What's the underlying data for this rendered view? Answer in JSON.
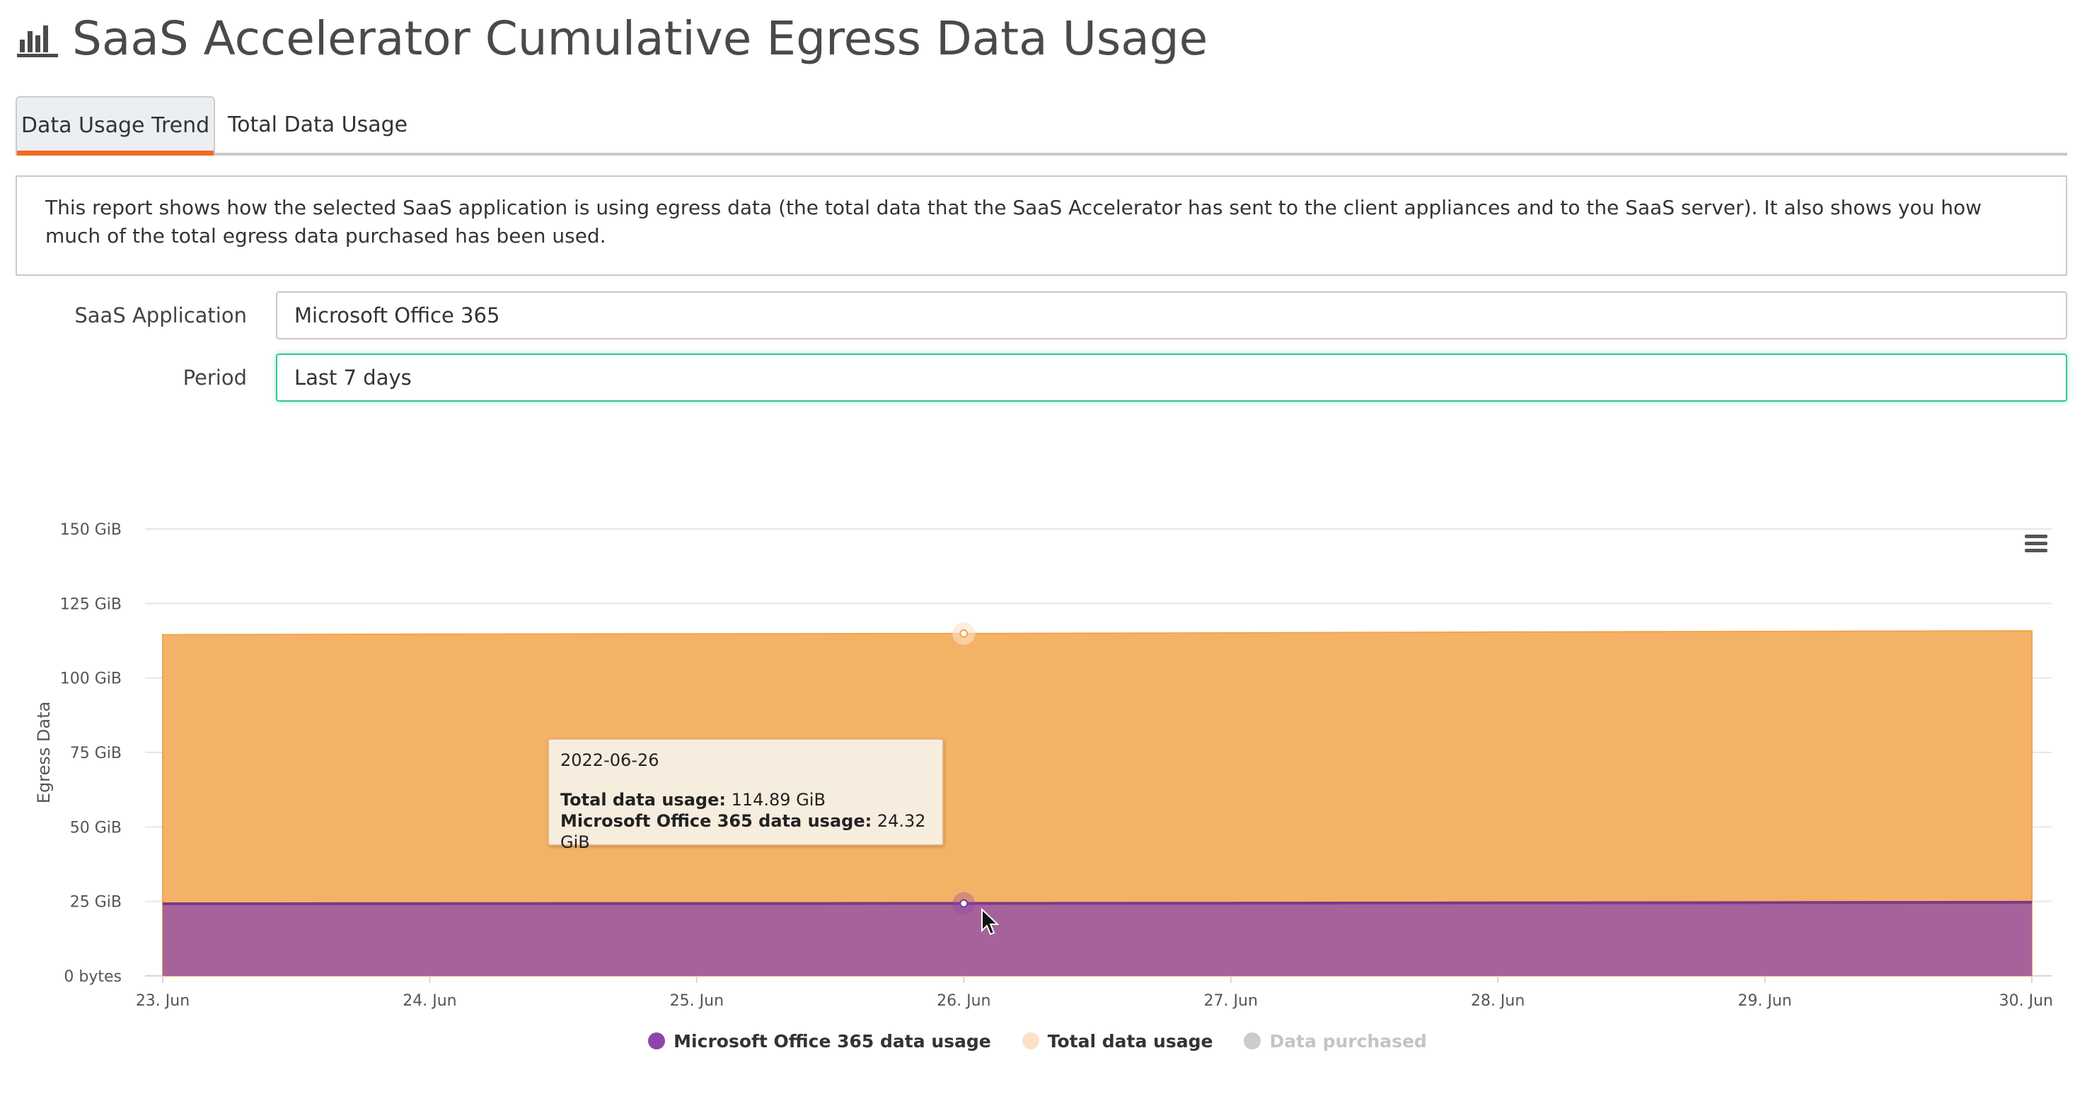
{
  "header": {
    "title": "SaaS Accelerator Cumulative Egress Data Usage",
    "icon": "bar-chart-icon"
  },
  "tabs": [
    {
      "label": "Data Usage Trend",
      "active": true
    },
    {
      "label": "Total Data Usage",
      "active": false
    }
  ],
  "description": "This report shows how the selected SaaS application is using egress data (the total data that the SaaS Accelerator has sent to the client appliances and to the SaaS server). It also shows you how much of the total egress data purchased has been used.",
  "form": {
    "application_label": "SaaS Application",
    "application_value": "Microsoft Office 365",
    "period_label": "Period",
    "period_value": "Last 7 days"
  },
  "colors": {
    "total_area": "#f4b266",
    "app_area": "#a6629b",
    "app_line": "#7b3a8a",
    "accent_tab": "#f26b22",
    "focus_border": "#31c6a0",
    "legend_app": "#8e44ad",
    "legend_total": "#fbe2c6",
    "legend_purchased": "#cccccc"
  },
  "tooltip": {
    "date": "2022-06-26",
    "total_label": "Total data usage:",
    "total_value": "114.89 GiB",
    "app_label": "Microsoft Office 365 data usage:",
    "app_value": "24.32 GiB"
  },
  "chart_data": {
    "type": "area",
    "ylabel": "Egress Data",
    "xlabel": "",
    "ylim": [
      0,
      150
    ],
    "yticks": [
      0,
      25,
      50,
      75,
      100,
      125,
      150
    ],
    "ytick_labels": [
      "0 bytes",
      "25 GiB",
      "50 GiB",
      "75 GiB",
      "100 GiB",
      "125 GiB",
      "150 GiB"
    ],
    "x": [
      "23. Jun",
      "24. Jun",
      "25. Jun",
      "26. Jun",
      "27. Jun",
      "28. Jun",
      "29. Jun",
      "30. Jun"
    ],
    "grid": true,
    "legend_position": "bottom",
    "series": [
      {
        "name": "Microsoft Office 365 data usage",
        "values": [
          24.2,
          24.25,
          24.3,
          24.32,
          24.4,
          24.5,
          24.6,
          24.7
        ]
      },
      {
        "name": "Total data usage",
        "values": [
          114.5,
          114.7,
          114.8,
          114.89,
          115.1,
          115.4,
          115.6,
          115.8
        ]
      },
      {
        "name": "Data purchased",
        "values": [],
        "hidden": true
      }
    ],
    "highlight_index": 3
  }
}
